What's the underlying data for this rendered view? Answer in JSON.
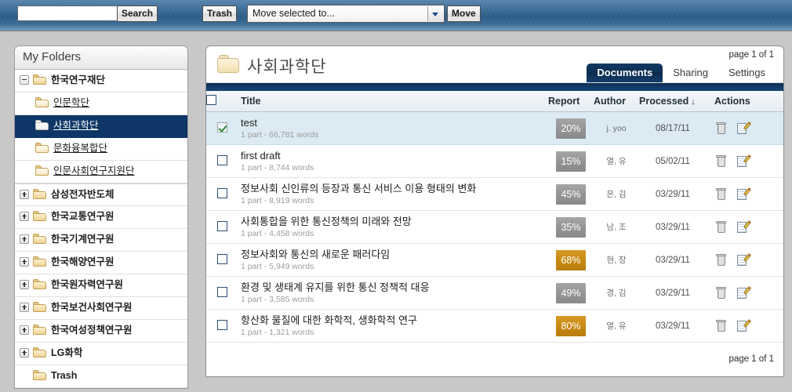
{
  "toolbar": {
    "search_value": "",
    "search_placeholder": "",
    "search_button": "Search",
    "trash_button": "Trash",
    "move_select_value": "Move selected to...",
    "move_button": "Move"
  },
  "sidebar": {
    "heading": "My Folders",
    "items": [
      {
        "label": "한국연구재단",
        "level": 0,
        "expander": "minus",
        "bold": true,
        "selected": false,
        "link": false,
        "gap": false,
        "folder": "closed"
      },
      {
        "label": "인문학단",
        "level": 1,
        "expander": "none",
        "bold": false,
        "selected": false,
        "link": true,
        "gap": false,
        "folder": "open"
      },
      {
        "label": "사회과학단",
        "level": 1,
        "expander": "none",
        "bold": false,
        "selected": true,
        "link": true,
        "gap": false,
        "folder": "white"
      },
      {
        "label": "문화융복합단",
        "level": 1,
        "expander": "none",
        "bold": false,
        "selected": false,
        "link": true,
        "gap": false,
        "folder": "open"
      },
      {
        "label": "인문사회연구지원단",
        "level": 1,
        "expander": "none",
        "bold": false,
        "selected": false,
        "link": true,
        "gap": false,
        "folder": "open"
      },
      {
        "label": "삼성전자반도체",
        "level": 0,
        "expander": "plus",
        "bold": true,
        "selected": false,
        "link": false,
        "gap": true,
        "folder": "closed"
      },
      {
        "label": "한국교통연구원",
        "level": 0,
        "expander": "plus",
        "bold": true,
        "selected": false,
        "link": false,
        "gap": false,
        "folder": "closed"
      },
      {
        "label": "한국기계연구원",
        "level": 0,
        "expander": "plus",
        "bold": true,
        "selected": false,
        "link": false,
        "gap": false,
        "folder": "closed"
      },
      {
        "label": "한국해양연구원",
        "level": 0,
        "expander": "plus",
        "bold": true,
        "selected": false,
        "link": false,
        "gap": false,
        "folder": "closed"
      },
      {
        "label": "한국원자력연구원",
        "level": 0,
        "expander": "plus",
        "bold": true,
        "selected": false,
        "link": false,
        "gap": false,
        "folder": "closed"
      },
      {
        "label": "한국보건사회연구원",
        "level": 0,
        "expander": "plus",
        "bold": true,
        "selected": false,
        "link": false,
        "gap": false,
        "folder": "closed"
      },
      {
        "label": "한국여성정책연구원",
        "level": 0,
        "expander": "plus",
        "bold": true,
        "selected": false,
        "link": false,
        "gap": false,
        "folder": "closed"
      },
      {
        "label": "LG화학",
        "level": 0,
        "expander": "plus",
        "bold": true,
        "selected": false,
        "link": false,
        "gap": false,
        "folder": "closed"
      },
      {
        "label": "Trash",
        "level": 0,
        "expander": "none",
        "bold": true,
        "selected": false,
        "link": false,
        "gap": false,
        "folder": "closed"
      }
    ]
  },
  "main": {
    "folder_title": "사회과학단",
    "page_indicator_top": "page 1 of 1",
    "page_indicator_bottom": "page 1 of 1",
    "tabs": [
      {
        "label": "Documents",
        "active": true
      },
      {
        "label": "Sharing",
        "active": false
      },
      {
        "label": "Settings",
        "active": false
      }
    ],
    "columns": {
      "title": "Title",
      "report": "Report",
      "author": "Author",
      "processed": "Processed",
      "sort_arrow": "↓",
      "actions": "Actions"
    },
    "rows": [
      {
        "checked": true,
        "title": "test",
        "meta": "1 part - 66,781 words",
        "report": "20%",
        "report_color": "gray",
        "author": "j. yoo",
        "processed": "08/17/11"
      },
      {
        "checked": false,
        "title": "first draft",
        "meta": "1 part - 8,744 words",
        "report": "15%",
        "report_color": "gray",
        "author": "열, 유",
        "processed": "05/02/11"
      },
      {
        "checked": false,
        "title": "정보사회 신인류의 등장과 통신 서비스 이용 형태의 변화",
        "meta": "1 part - 8,919 words",
        "report": "45%",
        "report_color": "gray",
        "author": "은, 김",
        "processed": "03/29/11"
      },
      {
        "checked": false,
        "title": "사회통합을 위한 통신정책의 미래와 전망",
        "meta": "1 part - 4,458 words",
        "report": "35%",
        "report_color": "gray",
        "author": "남, 조",
        "processed": "03/29/11"
      },
      {
        "checked": false,
        "title": "정보사회와 통신의 새로운 패러다임",
        "meta": "1 part - 5,949 words",
        "report": "68%",
        "report_color": "amber",
        "author": "현, 장",
        "processed": "03/29/11"
      },
      {
        "checked": false,
        "title": "환경 및 생태계 유지를 위한 통신 정책적 대응",
        "meta": "1 part - 3,585 words",
        "report": "49%",
        "report_color": "gray",
        "author": "경, 김",
        "processed": "03/29/11"
      },
      {
        "checked": false,
        "title": "항산화 물질에 대한 화학적, 생화학적 연구",
        "meta": "1 part - 1,321 words",
        "report": "80%",
        "report_color": "amber",
        "author": "열, 유",
        "processed": "03/29/11"
      }
    ],
    "row_actions": {
      "delete": "delete",
      "edit": "edit"
    }
  },
  "colors": {
    "toolbar_blue": "#2c5c86",
    "selected_nav": "#0e3767",
    "active_tab": "#0c2c50",
    "badge_gray": "#949494",
    "badge_amber": "#c98a12",
    "row_selected": "#dbeaf3"
  }
}
